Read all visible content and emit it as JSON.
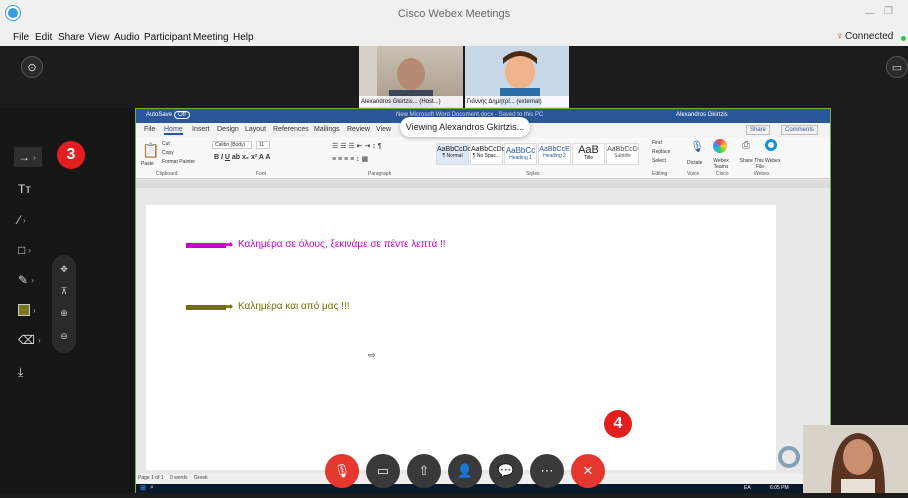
{
  "app": {
    "title": "Cisco Webex Meetings"
  },
  "menu": [
    "File",
    "Edit",
    "Share",
    "View",
    "Audio",
    "Participant",
    "Meeting",
    "Help"
  ],
  "status": {
    "connected": "Connected"
  },
  "participants": [
    {
      "label": "Alexandros Gkirtzis... (Host...)"
    },
    {
      "label": "Γιάννης Δημητρί... (external)"
    }
  ],
  "badges": {
    "three": "3",
    "four": "4"
  },
  "share_banner": "Viewing Alexandros Gkirtzis...",
  "word": {
    "autosave": "AutoSave",
    "toggle": "Off",
    "title_center": "New Microsoft Word Document.docx - Saved to this PC",
    "user": "Alexandros Gkirtzis",
    "tabs": [
      "File",
      "Home",
      "Insert",
      "Design",
      "Layout",
      "References",
      "Mailings",
      "Review",
      "View"
    ],
    "share": "Share",
    "comments": "Comments",
    "ribbon_groups": [
      "Clipboard",
      "Font",
      "Paragraph",
      "Styles",
      "Editing",
      "Voice",
      "Cisco",
      "Webex"
    ],
    "clipboard": {
      "paste": "Paste",
      "cut": "Cut",
      "copy": "Copy",
      "format_painter": "Format Painter"
    },
    "font": {
      "name": "Calibri (Body)",
      "size": "11"
    },
    "styles": [
      {
        "sample": "AaBbCcDd",
        "name": "¶ Normal"
      },
      {
        "sample": "AaBbCcDd",
        "name": "¶ No Spac..."
      },
      {
        "sample": "AaBbCc",
        "name": "Heading 1"
      },
      {
        "sample": "AaBbCcE",
        "name": "Heading 2"
      },
      {
        "sample": "AaB",
        "name": "Title"
      },
      {
        "sample": "AaBbCcD",
        "name": "Subtitle"
      }
    ],
    "editing": {
      "find": "Find",
      "replace": "Replace",
      "select": "Select"
    },
    "voice": {
      "dictate": "Dictate"
    },
    "cisco": {
      "webex_teams": "Webex Teams"
    },
    "webex": {
      "share_this": "Share This Webex File"
    },
    "doc_line1": "Καλημέρα σε όλους, ξεκινάμε σε πέντε λεπτά !!",
    "doc_line2": "Καλημέρα και από μας !!!",
    "status": {
      "page": "Page 1 of 1",
      "words": "0 words",
      "lang": "Greek"
    },
    "taskbar_time": "6:05 PM",
    "taskbar_lang": "EA"
  },
  "colors": {
    "line1": "#cc00cc",
    "line2": "#707000",
    "end_call": "#e5362f",
    "badge": "#e41e1e",
    "word_blue": "#2b579a"
  },
  "icons": {
    "tools": [
      "arrow-pointer-icon",
      "text-icon",
      "line-icon",
      "rectangle-icon",
      "pen-icon",
      "color-swatch-icon",
      "eraser-icon",
      "save-icon"
    ],
    "controls": [
      "mute-icon",
      "video-icon",
      "share-icon",
      "participants-icon",
      "chat-icon",
      "more-icon",
      "end-call-icon"
    ]
  }
}
